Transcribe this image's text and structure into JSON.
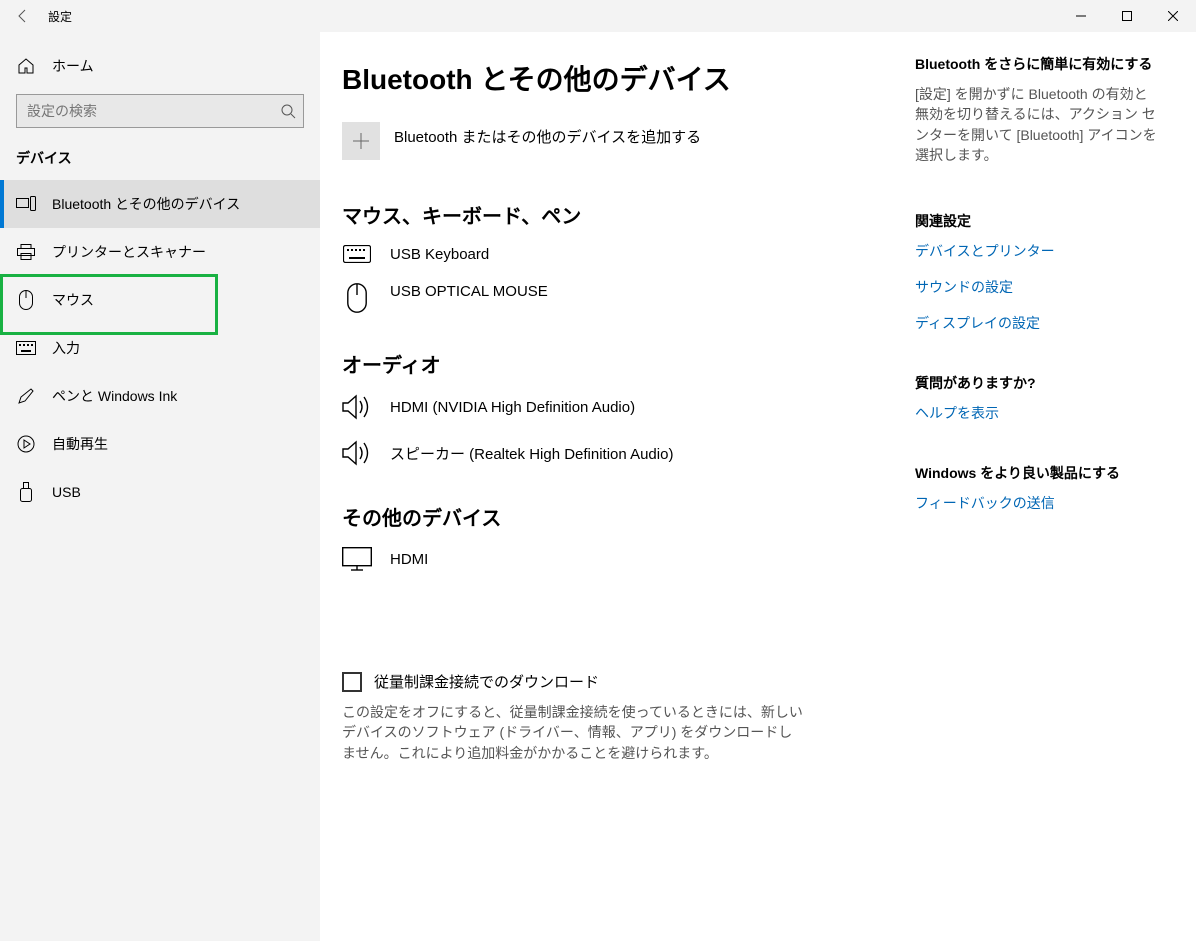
{
  "window": {
    "app_title": "設定",
    "min": "Minimize",
    "max": "Maximize",
    "close": "Close"
  },
  "sidebar": {
    "home_label": "ホーム",
    "search_placeholder": "設定の検索",
    "category_heading": "デバイス",
    "items": [
      {
        "label": "Bluetooth とその他のデバイス"
      },
      {
        "label": "プリンターとスキャナー"
      },
      {
        "label": "マウス"
      },
      {
        "label": "入力"
      },
      {
        "label": "ペンと Windows Ink"
      },
      {
        "label": "自動再生"
      },
      {
        "label": "USB"
      }
    ]
  },
  "page": {
    "title": "Bluetooth とその他のデバイス",
    "add_device_label": "Bluetooth またはその他のデバイスを追加する",
    "sections": {
      "input_h": "マウス、キーボード、ペン",
      "input_devices": [
        {
          "name": "USB Keyboard"
        },
        {
          "name": "USB OPTICAL MOUSE"
        }
      ],
      "audio_h": "オーディオ",
      "audio_devices": [
        {
          "name": "HDMI (NVIDIA High Definition Audio)"
        },
        {
          "name": "スピーカー (Realtek High Definition Audio)"
        }
      ],
      "other_h": "その他のデバイス",
      "other_devices": [
        {
          "name": "HDMI"
        }
      ]
    },
    "metered": {
      "checkbox_label": "従量制課金接続でのダウンロード",
      "description": "この設定をオフにすると、従量制課金接続を使っているときには、新しいデバイスのソフトウェア (ドライバー、情報、アプリ) をダウンロードしません。これにより追加料金がかかることを避けられます。"
    }
  },
  "sidepanel": {
    "bt_tip_h": "Bluetooth をさらに簡単に有効にする",
    "bt_tip_desc": "[設定] を開かずに Bluetooth の有効と無効を切り替えるには、アクション センターを開いて [Bluetooth] アイコンを選択します。",
    "related_h": "関連設定",
    "related_links": [
      "デバイスとプリンター",
      "サウンドの設定",
      "ディスプレイの設定"
    ],
    "help_h": "質問がありますか?",
    "help_link": "ヘルプを表示",
    "feedback_h": "Windows をより良い製品にする",
    "feedback_link": "フィードバックの送信"
  }
}
